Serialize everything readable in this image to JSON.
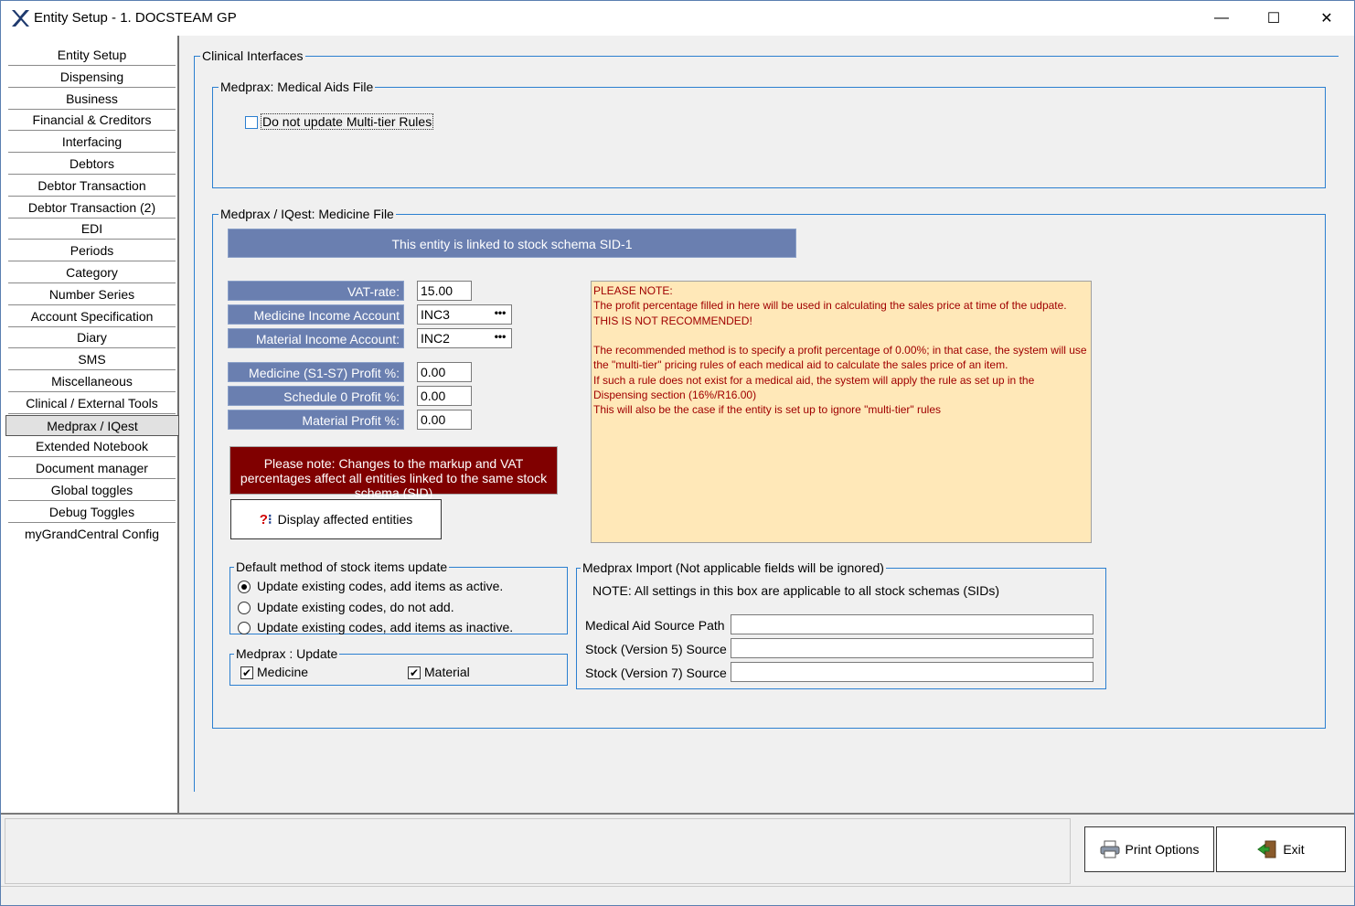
{
  "window": {
    "title": "Entity Setup - 1. DOCSTEAM GP",
    "min_symbol": "—",
    "max_symbol": "☐",
    "close_symbol": "✕"
  },
  "sidebar": {
    "items": [
      {
        "label": "Entity Setup"
      },
      {
        "label": "Dispensing"
      },
      {
        "label": "Business"
      },
      {
        "label": "Financial & Creditors"
      },
      {
        "label": "Interfacing"
      },
      {
        "label": "Debtors"
      },
      {
        "label": "Debtor Transaction"
      },
      {
        "label": "Debtor Transaction (2)"
      },
      {
        "label": "EDI"
      },
      {
        "label": "Periods"
      },
      {
        "label": "Category"
      },
      {
        "label": "Number Series"
      },
      {
        "label": "Account Specification"
      },
      {
        "label": "Diary"
      },
      {
        "label": "SMS"
      },
      {
        "label": "Miscellaneous"
      },
      {
        "label": "Clinical / External Tools"
      },
      {
        "label": "Medprax / IQest",
        "active": true
      },
      {
        "label": "Extended Notebook"
      },
      {
        "label": "Document manager"
      },
      {
        "label": "Global toggles"
      },
      {
        "label": "Debug Toggles"
      },
      {
        "label": "myGrandCentral Config"
      }
    ]
  },
  "clinical": {
    "title": "Clinical Interfaces",
    "medical_aids": {
      "title": "Medprax: Medical Aids File",
      "no_update_label": "Do not update Multi-tier Rules",
      "no_update_checked": false
    },
    "medicine_file": {
      "title": "Medprax / IQest: Medicine File",
      "schema_banner": "This entity is linked to stock schema  SID-1",
      "vat_label": "VAT-rate:",
      "vat_value": "15.00",
      "med_income_label": "Medicine Income Account",
      "med_income_value": "INC3",
      "mat_income_label": "Material Income Account:",
      "mat_income_value": "INC2",
      "ellipsis": "•••",
      "med_profit_label": "Medicine (S1-S7) Profit %:",
      "med_profit_value": "0.00",
      "sched0_profit_label": "Schedule 0 Profit %:",
      "sched0_profit_value": "0.00",
      "mat_profit_label": "Material Profit %:",
      "mat_profit_value": "0.00",
      "warning": "Please note: Changes to the markup and VAT percentages affect all entities linked to the same stock schema (SID)",
      "display_button": "Display affected entities",
      "note": "PLEASE NOTE:\nThe profit percentage filled in here will be used in calculating the sales price at time of the udpate. THIS IS NOT RECOMMENDED!\n\nThe recommended method is to specify a profit percentage of 0.00%; in that case, the system will use the \"multi-tier\" pricing rules of each medical aid to calculate the sales price of an item.\nIf such a rule does not exist for a medical aid, the system will apply the rule as set up in the Dispensing section (16%/R16.00)\nThis will also be the case if the entity is set up to ignore \"multi-tier\" rules"
    },
    "default_method": {
      "title": "Default method of stock items update",
      "options": [
        {
          "label": "Update existing codes, add items as active.",
          "selected": true
        },
        {
          "label": "Update existing codes, do not add.",
          "selected": false
        },
        {
          "label": "Update existing codes, add items as inactive.",
          "selected": false
        }
      ]
    },
    "medprax_update": {
      "title": "Medprax : Update",
      "medicine_label": "Medicine",
      "medicine_checked": true,
      "material_label": "Material",
      "material_checked": true,
      "check_mark": "✔"
    },
    "medprax_import": {
      "title": "Medprax Import  (Not applicable fields will be ignored)",
      "note": "NOTE:  All settings in this box are applicable to all stock schemas (SIDs)",
      "source_path_label": "Medical Aid Source Path",
      "source_path_value": "",
      "stock_v5_label": "Stock (Version 5) Source",
      "stock_v5_value": "",
      "stock_v7_label": "Stock (Version 7) Source",
      "stock_v7_value": ""
    }
  },
  "footer": {
    "print_label": "Print Options",
    "exit_label": "Exit"
  }
}
